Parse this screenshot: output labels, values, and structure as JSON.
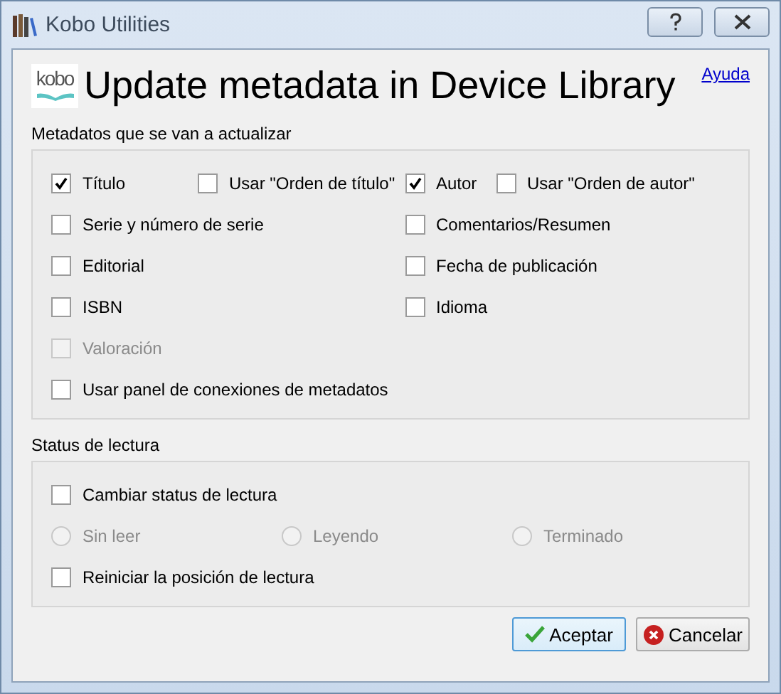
{
  "window": {
    "title": "Kobo Utilities"
  },
  "header": {
    "logo_text": "kobo",
    "title": "Update metadata in Device Library",
    "help_link": "Ayuda"
  },
  "metadata_group": {
    "title": "Metadatos que se van a actualizar",
    "rows": [
      {
        "left": [
          {
            "label": "Título",
            "checked": true,
            "disabled": false
          },
          {
            "label": "Usar \"Orden de título\"",
            "checked": false,
            "disabled": false
          }
        ],
        "right": [
          {
            "label": "Autor",
            "checked": true,
            "disabled": false
          },
          {
            "label": "Usar \"Orden de autor\"",
            "checked": false,
            "disabled": false
          }
        ]
      },
      {
        "left": [
          {
            "label": "Serie y número de serie",
            "checked": false,
            "disabled": false
          }
        ],
        "right": [
          {
            "label": "Comentarios/Resumen",
            "checked": false,
            "disabled": false
          }
        ]
      },
      {
        "left": [
          {
            "label": "Editorial",
            "checked": false,
            "disabled": false
          }
        ],
        "right": [
          {
            "label": "Fecha de publicación",
            "checked": false,
            "disabled": false
          }
        ]
      },
      {
        "left": [
          {
            "label": "ISBN",
            "checked": false,
            "disabled": false
          }
        ],
        "right": [
          {
            "label": "Idioma",
            "checked": false,
            "disabled": false
          }
        ]
      },
      {
        "left": [
          {
            "label": "Valoración",
            "checked": false,
            "disabled": true
          }
        ],
        "right": []
      },
      {
        "left": [
          {
            "label": "Usar panel de conexiones de metadatos",
            "checked": false,
            "disabled": false
          }
        ],
        "right": []
      }
    ]
  },
  "reading_group": {
    "title": "Status de lectura",
    "change": {
      "label": "Cambiar status de lectura",
      "checked": false,
      "disabled": false
    },
    "radios": [
      {
        "label": "Sin leer",
        "selected": false,
        "disabled": true
      },
      {
        "label": "Leyendo",
        "selected": false,
        "disabled": true
      },
      {
        "label": "Terminado",
        "selected": false,
        "disabled": true
      }
    ],
    "reset": {
      "label": "Reiniciar la posición de lectura",
      "checked": false,
      "disabled": false
    }
  },
  "buttons": [
    {
      "label": "Aceptar",
      "kind": "ok",
      "focused": true
    },
    {
      "label": "Cancelar",
      "kind": "cancel",
      "focused": false
    }
  ]
}
